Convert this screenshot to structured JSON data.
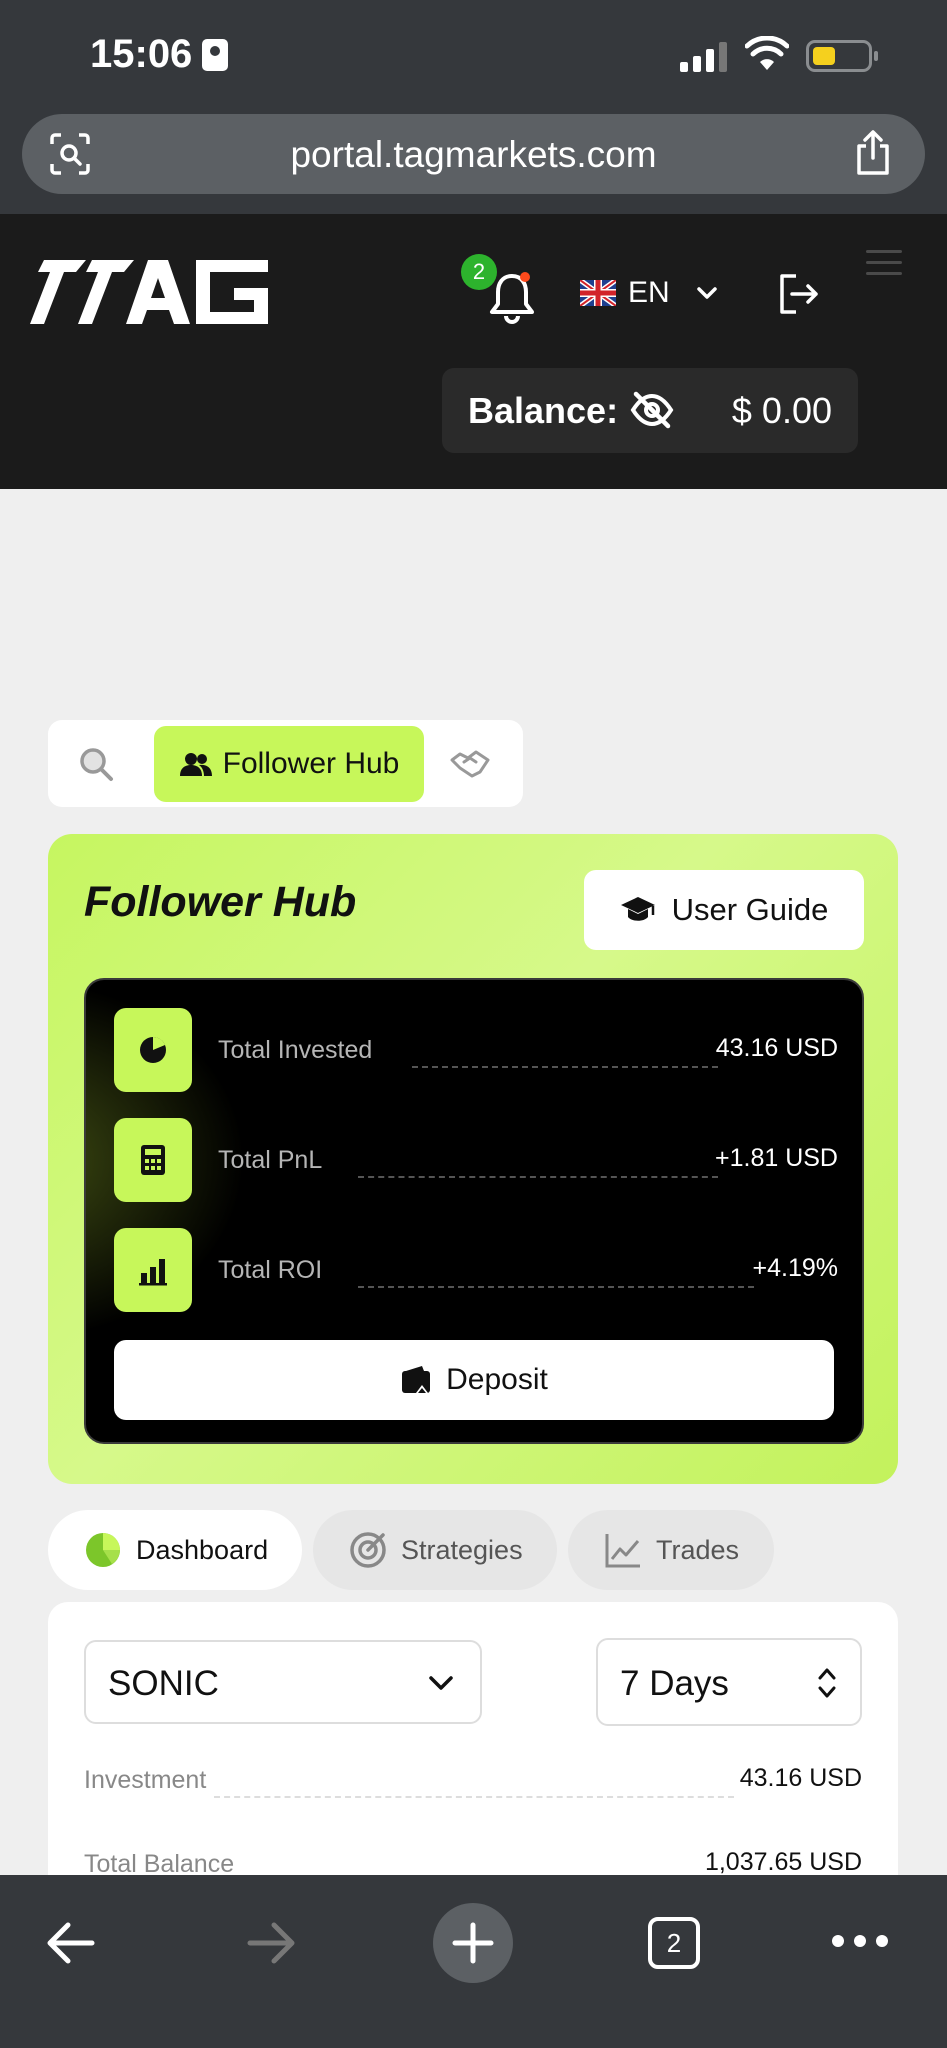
{
  "status_bar": {
    "time": "15:06"
  },
  "browser": {
    "url": "portal.tagmarkets.com",
    "tab_count": "2"
  },
  "header": {
    "logo_text": "TAG",
    "notification_count": "2",
    "language": "EN",
    "balance_label": "Balance:",
    "balance_value": "$ 0.00"
  },
  "switcher": {
    "active_label": "Follower Hub"
  },
  "hub": {
    "title": "Follower Hub",
    "guide_label": "User Guide",
    "stats": [
      {
        "label": "Total Invested",
        "value": "43.16 USD",
        "icon": "pie-chart-icon"
      },
      {
        "label": "Total PnL",
        "value": "+1.81 USD",
        "icon": "calculator-icon"
      },
      {
        "label": "Total ROI",
        "value": "+4.19%",
        "icon": "bar-chart-icon"
      }
    ],
    "deposit_label": "Deposit"
  },
  "subtabs": {
    "dashboard": "Dashboard",
    "strategies": "Strategies",
    "trades": "Trades"
  },
  "dashboard": {
    "strategy_select": "SONIC",
    "period_select": "7 Days",
    "rows": [
      {
        "label": "Investment",
        "value": "43.16 USD"
      },
      {
        "label": "Total Balance",
        "value": "1,037.65 USD"
      }
    ]
  },
  "colors": {
    "accent": "#c7f75a",
    "dark": "#1b1b1b",
    "browser_chrome": "#35383c"
  }
}
